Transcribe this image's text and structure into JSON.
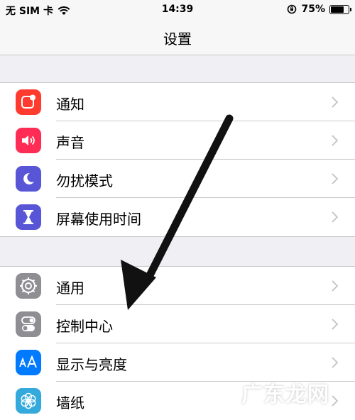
{
  "status_bar": {
    "carrier": "无 SIM 卡",
    "time": "14:39",
    "battery_text": "75%",
    "battery_level": 0.75
  },
  "nav": {
    "title": "设置"
  },
  "groups": [
    {
      "items": [
        {
          "label": "通知",
          "icon": "notifications-icon",
          "color": "#ff3b30"
        },
        {
          "label": "声音",
          "icon": "sounds-icon",
          "color": "#ff2d55"
        },
        {
          "label": "勿扰模式",
          "icon": "moon-icon",
          "color": "#5856d6"
        },
        {
          "label": "屏幕使用时间",
          "icon": "hourglass-icon",
          "color": "#5856d6"
        }
      ]
    },
    {
      "items": [
        {
          "label": "通用",
          "icon": "gear-icon",
          "color": "#8e8e93"
        },
        {
          "label": "控制中心",
          "icon": "toggles-icon",
          "color": "#8e8e93"
        },
        {
          "label": "显示与亮度",
          "icon": "text-size-icon",
          "color": "#007aff"
        },
        {
          "label": "墙纸",
          "icon": "flower-icon",
          "color": "#34aadc"
        }
      ]
    }
  ],
  "watermark": "广东龙网"
}
